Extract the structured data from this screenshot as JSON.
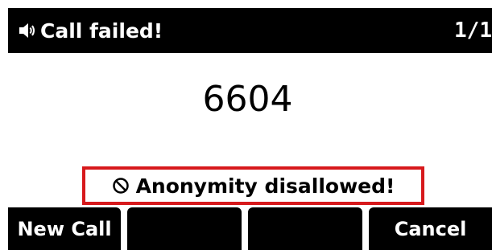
{
  "title_bar": {
    "icon": "speaker-icon",
    "title": "Call failed!",
    "counter": "1/1"
  },
  "call": {
    "number": "6604"
  },
  "status": {
    "icon": "blocked-icon",
    "message": "Anonymity disallowed!",
    "highlight_color": "#d7191c"
  },
  "softkeys": [
    {
      "label": "New Call"
    },
    {
      "label": ""
    },
    {
      "label": ""
    },
    {
      "label": "Cancel"
    }
  ]
}
